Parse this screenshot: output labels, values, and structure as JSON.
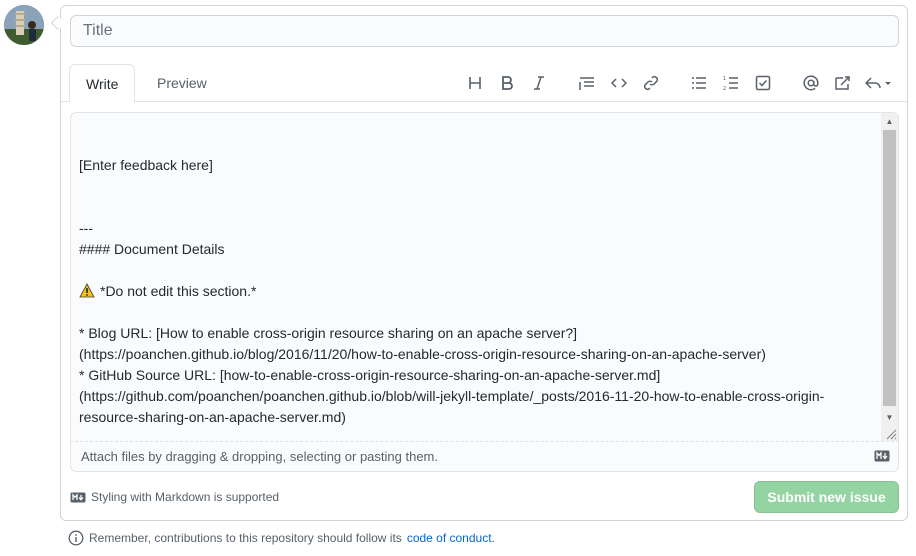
{
  "issue_form": {
    "title_placeholder": "Title",
    "tabs": [
      {
        "label": "Write",
        "active": true
      },
      {
        "label": "Preview",
        "active": false
      }
    ],
    "toolbar": [
      "heading-icon",
      "bold-icon",
      "italic-icon",
      "quote-icon",
      "code-icon",
      "link-icon",
      "bulleted-list-icon",
      "numbered-list-icon",
      "task-list-icon",
      "mention-icon",
      "reference-icon",
      "reply-icon"
    ],
    "body_lines": [
      "",
      "",
      "[Enter feedback here]",
      "",
      "",
      "---",
      "#### Document Details",
      "",
      "*Do not edit this section.*",
      "",
      "* Blog URL: [How to enable cross-origin resource sharing on an apache server?]",
      "(https://poanchen.github.io/blog/2016/11/20/how-to-enable-cross-origin-resource-sharing-on-an-apache-server)",
      "* GitHub Source URL: [how-to-enable-cross-origin-resource-sharing-on-an-apache-server.md]",
      "(https://github.com/poanchen/poanchen.github.io/blob/will-jekyll-template/_posts/2016-11-20-how-to-enable-cross-origin-",
      "resource-sharing-on-an-apache-server.md)"
    ],
    "warning_emoji": "⚠️",
    "attach_text": "Attach files by dragging & dropping, selecting or pasting them.",
    "markdown_note": "Styling with Markdown is supported",
    "submit_label": "Submit new issue",
    "submit_color": "#94d3a2"
  },
  "footer": {
    "text": "Remember, contributions to this repository should follow its",
    "link": "code of conduct",
    "period": "."
  }
}
